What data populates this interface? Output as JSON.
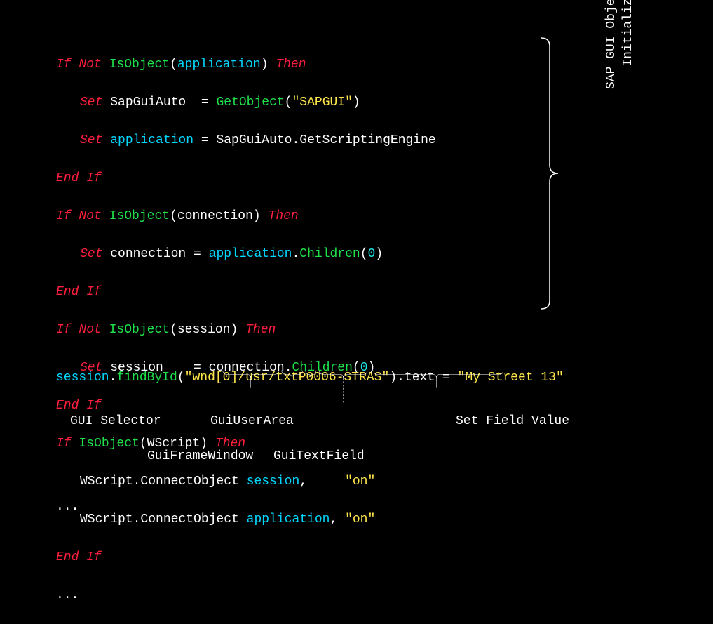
{
  "code": {
    "l1_if": "If",
    "l1_not": "Not",
    "l1_isobject": "IsObject",
    "l1_app": "application",
    "l1_then": "Then",
    "l2_set": "Set",
    "l2_sapguiauto": "SapGuiAuto ",
    "l2_eq": " = ",
    "l2_getobject": "GetObject",
    "l2_paren_open": "(",
    "l2_sapgui": "\"SAPGUI\"",
    "l2_paren_close": ")",
    "l3_set": "Set",
    "l3_application": "application",
    "l3_eq": " = ",
    "l3_rhs": "SapGuiAuto.GetScriptingEngine",
    "l4_endif": "End If",
    "l5_if": "If",
    "l5_not": "Not",
    "l5_isobject": "IsObject",
    "l5_conn": "connection",
    "l5_then": "Then",
    "l6_set": "Set",
    "l6_connection": "connection",
    "l6_eq": " = ",
    "l6_app": "application",
    "l6_children": "Children",
    "l6_zero": "0",
    "l7_endif": "End If",
    "l8_if": "If",
    "l8_not": "Not",
    "l8_isobject": "IsObject",
    "l8_session": "session",
    "l8_then": "Then",
    "l9_set": "Set",
    "l9_session": "session   ",
    "l9_eq": " = ",
    "l9_conn": "connection",
    "l9_children": "Children",
    "l9_zero": "0",
    "l10_endif": "End If",
    "l11_if": "If",
    "l11_isobject": "IsObject",
    "l11_wscript": "WScript",
    "l11_then": "Then",
    "l12_pre": "WScript.ConnectObject ",
    "l12_session": "session",
    "l12_comma_pad": ",     ",
    "l12_on": "\"on\"",
    "l13_pre": "WScript.ConnectObject ",
    "l13_app": "application",
    "l13_comma": ", ",
    "l13_on": "\"on\"",
    "l14_endif": "End If",
    "ellipsis": "...",
    "line2": {
      "session": "session",
      "dot": ".",
      "findbyid": "findById",
      "paren_open": "(",
      "path": "\"wnd[0]/usr/txtP0006-STRAS\"",
      "paren_close_dot_text": ").text = ",
      "value": "\"My Street 13\""
    }
  },
  "side_label": {
    "line1": "SAP GUI Object Model",
    "line2": "Initialization"
  },
  "labels": {
    "gui_selector": "GUI Selector",
    "gui_frame_window": "GuiFrameWindow",
    "gui_user_area": "GuiUserArea",
    "gui_text_field": "GuiTextField",
    "set_field_value": "Set Field Value"
  },
  "ellipsis_bottom": "..."
}
